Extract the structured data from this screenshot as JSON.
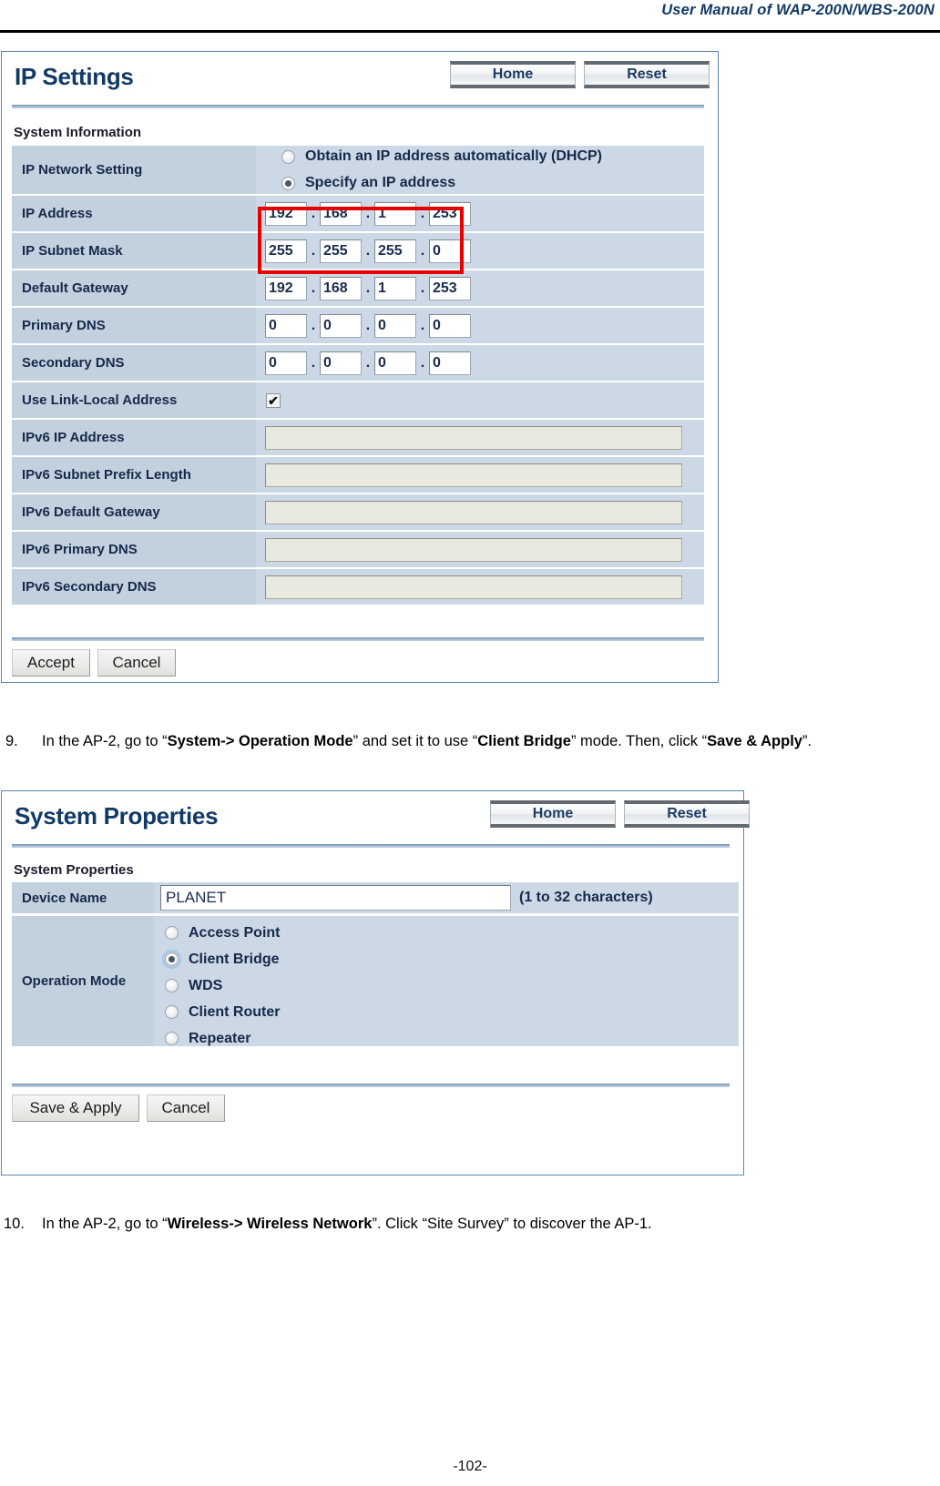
{
  "header": {
    "title": "User Manual of WAP-200N/WBS-200N"
  },
  "ip_settings_panel": {
    "title": "IP Settings",
    "home_label": "Home",
    "reset_label": "Reset",
    "section_label": "System Information",
    "rows": {
      "ip_network_setting": {
        "label": "IP Network Setting",
        "options": [
          {
            "label": "Obtain an IP address automatically (DHCP)",
            "selected": false
          },
          {
            "label": "Specify an IP address",
            "selected": true
          }
        ]
      },
      "ip_address": {
        "label": "IP Address",
        "octets": [
          "192",
          "168",
          "1",
          "253"
        ]
      },
      "ip_subnet_mask": {
        "label": "IP Subnet Mask",
        "octets": [
          "255",
          "255",
          "255",
          "0"
        ]
      },
      "default_gateway": {
        "label": "Default Gateway",
        "octets": [
          "192",
          "168",
          "1",
          "253"
        ]
      },
      "primary_dns": {
        "label": "Primary DNS",
        "octets": [
          "0",
          "0",
          "0",
          "0"
        ]
      },
      "secondary_dns": {
        "label": "Secondary DNS",
        "octets": [
          "0",
          "0",
          "0",
          "0"
        ]
      },
      "use_link_local": {
        "label": "Use Link-Local Address",
        "checked": true,
        "check_glyph": "✔"
      },
      "ipv6_ip_address": {
        "label": "IPv6 IP Address",
        "value": ""
      },
      "ipv6_subnet_prefix_length": {
        "label": "IPv6 Subnet Prefix Length",
        "value": ""
      },
      "ipv6_default_gateway": {
        "label": "IPv6 Default Gateway",
        "value": ""
      },
      "ipv6_primary_dns": {
        "label": "IPv6 Primary DNS",
        "value": ""
      },
      "ipv6_secondary_dns": {
        "label": "IPv6 Secondary DNS",
        "value": ""
      }
    },
    "accept_label": "Accept",
    "cancel_label": "Cancel",
    "dot_separator": "."
  },
  "instruction_9": {
    "number": "9.",
    "part1": "In the AP-2, go to “",
    "bold1": "System-> Operation Mode",
    "part2": "” and set it to use “",
    "bold2": "Client Bridge",
    "part3": "” mode. Then, click “",
    "bold3": "Save & Apply",
    "part4": "”."
  },
  "system_properties_panel": {
    "title": "System Properties",
    "home_label": "Home",
    "reset_label": "Reset",
    "section_label": "System Properties",
    "device_name": {
      "label": "Device Name",
      "value": "PLANET",
      "hint": "(1 to 32 characters)"
    },
    "operation_mode": {
      "label": "Operation Mode",
      "options": [
        {
          "label": "Access Point",
          "selected": false
        },
        {
          "label": "Client Bridge",
          "selected": true
        },
        {
          "label": "WDS",
          "selected": false
        },
        {
          "label": "Client Router",
          "selected": false
        },
        {
          "label": "Repeater",
          "selected": false
        }
      ]
    },
    "save_apply_label": "Save & Apply",
    "cancel_label": "Cancel"
  },
  "instruction_10": {
    "number": "10.",
    "part1": "In the AP-2, go to “",
    "bold1": "Wireless-> Wireless Network",
    "part2": "”. Click “Site Survey” to discover the AP-1."
  },
  "footer": {
    "page_number": "-102-"
  },
  "colors": {
    "header_text": "#123a66",
    "panel_border": "#5a86b5",
    "label_cell": "#c3d0de",
    "value_cell": "#ccd8e5",
    "annotation_red": "#e60000"
  }
}
